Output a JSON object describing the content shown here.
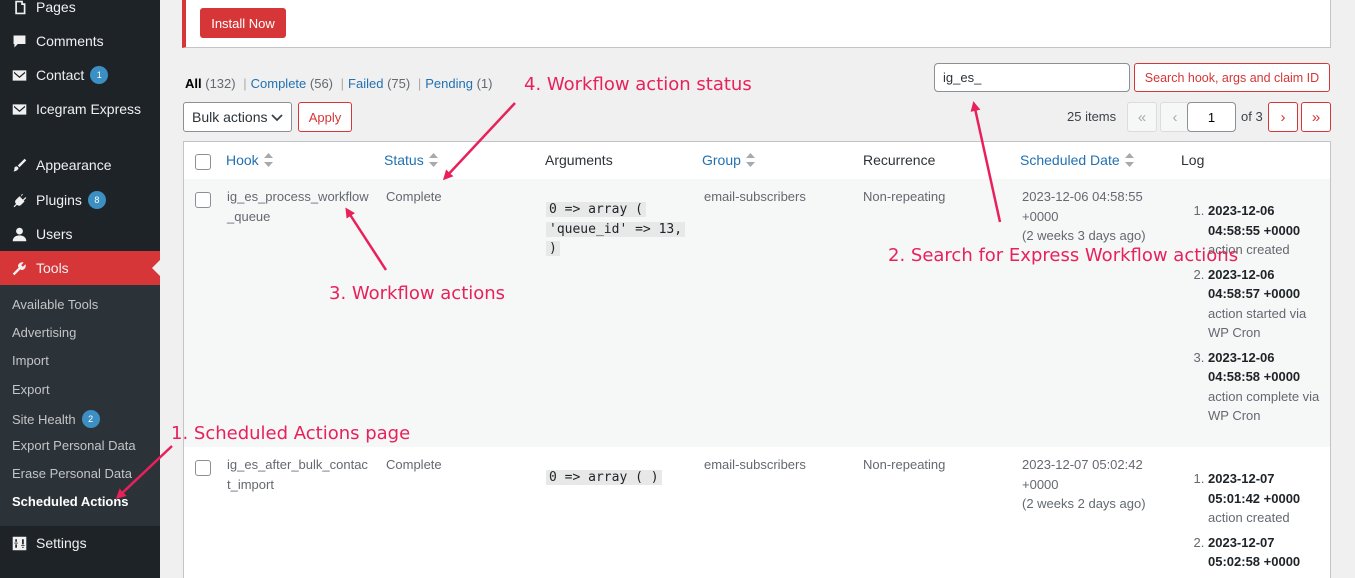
{
  "sidebar": {
    "items": [
      {
        "label": "Pages",
        "icon": "pages-icon"
      },
      {
        "label": "Comments",
        "icon": "comment-icon"
      },
      {
        "label": "Contact",
        "icon": "mail-icon",
        "badge": "1"
      },
      {
        "label": "Icegram Express",
        "icon": "mail-icon"
      },
      {
        "label": "Appearance",
        "icon": "paintbrush-icon"
      },
      {
        "label": "Plugins",
        "icon": "plugin-icon",
        "badge": "8"
      },
      {
        "label": "Users",
        "icon": "user-icon"
      },
      {
        "label": "Tools",
        "icon": "wrench-icon"
      },
      {
        "label": "Settings",
        "icon": "sliders-icon"
      }
    ],
    "submenu": [
      {
        "label": "Available Tools"
      },
      {
        "label": "Advertising"
      },
      {
        "label": "Import"
      },
      {
        "label": "Export"
      },
      {
        "label": "Site Health",
        "badge": "2"
      },
      {
        "label": "Export Personal Data"
      },
      {
        "label": "Erase Personal Data"
      },
      {
        "label": "Scheduled Actions"
      }
    ]
  },
  "notice": {
    "install_label": "Install Now"
  },
  "filters": {
    "all": "All",
    "all_count": "(132)",
    "complete": "Complete",
    "complete_count": "(56)",
    "failed": "Failed",
    "failed_count": "(75)",
    "pending": "Pending",
    "pending_count": "(1)",
    "separator": "|"
  },
  "search": {
    "value": "ig_es_",
    "button_label": "Search hook, args and claim ID"
  },
  "bulk": {
    "select_label": "Bulk actions",
    "apply_label": "Apply"
  },
  "pagination": {
    "items": "25 items",
    "first": "«",
    "prev": "‹",
    "current": "1",
    "of": "of 3",
    "next": "›",
    "last": "»"
  },
  "table": {
    "headers": [
      "Hook",
      "Status",
      "Arguments",
      "Group",
      "Recurrence",
      "Scheduled Date",
      "Log"
    ],
    "rows": [
      {
        "hook_line1": "ig_es_process_workflow",
        "hook_line2": "_queue",
        "status": "Complete",
        "args": [
          "0 => array (",
          "'queue_id' => 13,",
          ")"
        ],
        "group": "email-subscribers",
        "recurrence": "Non-repeating",
        "date_line1": "2023-12-06 04:58:55",
        "date_line2": "+0000",
        "date_line3": "(2 weeks 3 days ago)",
        "log": [
          {
            "date_line1": "2023-12-06",
            "date_line2": "04:58:55 +0000",
            "msg_line1": "action created",
            "msg_line2": ""
          },
          {
            "date_line1": "2023-12-06",
            "date_line2": "04:58:57 +0000",
            "msg_line1": "action started via",
            "msg_line2": "WP Cron"
          },
          {
            "date_line1": "2023-12-06",
            "date_line2": "04:58:58 +0000",
            "msg_line1": "action complete via",
            "msg_line2": "WP Cron"
          }
        ]
      },
      {
        "hook_line1": "ig_es_after_bulk_contac",
        "hook_line2": "t_import",
        "status": "Complete",
        "args": [
          "0 => array ( )"
        ],
        "group": "email-subscribers",
        "recurrence": "Non-repeating",
        "date_line1": "2023-12-07 05:02:42",
        "date_line2": "+0000",
        "date_line3": "(2 weeks 2 days ago)",
        "log": [
          {
            "date_line1": "2023-12-07",
            "date_line2": "05:01:42 +0000",
            "msg_line1": "action created",
            "msg_line2": ""
          },
          {
            "date_line1": "2023-12-07",
            "date_line2": "05:02:58 +0000",
            "msg_line1": "",
            "msg_line2": ""
          }
        ]
      }
    ]
  },
  "annotations": {
    "a1": "1. Scheduled Actions page",
    "a2": "2. Search for Express Workflow actions",
    "a3": "3. Workflow actions",
    "a4": "4. Workflow action status"
  },
  "colors": {
    "accent": "#d63638",
    "link": "#2271b1",
    "annotation": "#e8215a",
    "sidebar": "#1d2327"
  }
}
